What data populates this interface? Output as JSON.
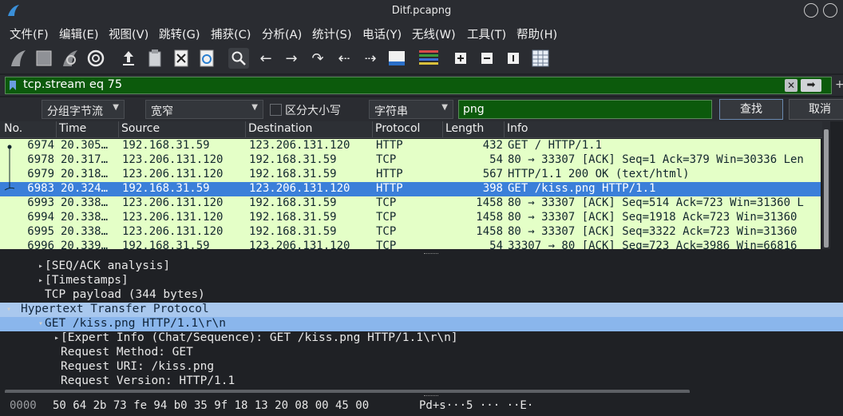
{
  "window": {
    "title": "Ditf.pcapng"
  },
  "menu": [
    "文件(F)",
    "编辑(E)",
    "视图(V)",
    "跳转(G)",
    "捕获(C)",
    "分析(A)",
    "统计(S)",
    "电话(Y)",
    "无线(W)",
    "工具(T)",
    "帮助(H)"
  ],
  "filter": {
    "value": "tcp.stream eq 75"
  },
  "find": {
    "scope": "分组字节流",
    "width": "宽窄",
    "case_label": "区分大小写",
    "type": "字符串",
    "query": "png",
    "find_button": "查找",
    "cancel_button": "取消"
  },
  "columns": [
    "No.",
    "Time",
    "Source",
    "Destination",
    "Protocol",
    "Length",
    "Info"
  ],
  "packets": [
    {
      "no": "6974",
      "time": "20.305…",
      "src": "192.168.31.59",
      "dst": "123.206.131.120",
      "proto": "HTTP",
      "len": "432",
      "info": "GET / HTTP/1.1",
      "selected": false
    },
    {
      "no": "6978",
      "time": "20.317…",
      "src": "123.206.131.120",
      "dst": "192.168.31.59",
      "proto": "TCP",
      "len": "54",
      "info": "80 → 33307 [ACK] Seq=1 Ack=379 Win=30336 Len",
      "selected": false
    },
    {
      "no": "6979",
      "time": "20.318…",
      "src": "123.206.131.120",
      "dst": "192.168.31.59",
      "proto": "HTTP",
      "len": "567",
      "info": "HTTP/1.1 200 OK  (text/html)",
      "selected": false
    },
    {
      "no": "6983",
      "time": "20.324…",
      "src": "192.168.31.59",
      "dst": "123.206.131.120",
      "proto": "HTTP",
      "len": "398",
      "info": "GET /kiss.png HTTP/1.1",
      "selected": true
    },
    {
      "no": "6993",
      "time": "20.338…",
      "src": "123.206.131.120",
      "dst": "192.168.31.59",
      "proto": "TCP",
      "len": "1458",
      "info": "80 → 33307 [ACK] Seq=514 Ack=723 Win=31360 L",
      "selected": false
    },
    {
      "no": "6994",
      "time": "20.338…",
      "src": "123.206.131.120",
      "dst": "192.168.31.59",
      "proto": "TCP",
      "len": "1458",
      "info": "80 → 33307 [ACK] Seq=1918 Ack=723 Win=31360",
      "selected": false
    },
    {
      "no": "6995",
      "time": "20.338…",
      "src": "123.206.131.120",
      "dst": "192.168.31.59",
      "proto": "TCP",
      "len": "1458",
      "info": "80 → 33307 [ACK] Seq=3322 Ack=723 Win=31360",
      "selected": false
    },
    {
      "no": "6996",
      "time": "20.339…",
      "src": "192.168.31.59",
      "dst": "123.206.131.120",
      "proto": "TCP",
      "len": "54",
      "info": "33307 → 80 [ACK] Seq=723 Ack=3986 Win=66816",
      "selected": false
    }
  ],
  "details": [
    {
      "indent": 1,
      "arrow": "▸",
      "text": "[SEQ/ACK analysis]",
      "highlight": ""
    },
    {
      "indent": 1,
      "arrow": "▸",
      "text": "[Timestamps]",
      "highlight": ""
    },
    {
      "indent": 1,
      "arrow": "",
      "text": "TCP payload (344 bytes)",
      "highlight": ""
    },
    {
      "indent": 0,
      "arrow": "▾",
      "text": "Hypertext Transfer Protocol",
      "highlight": "hl2"
    },
    {
      "indent": 1,
      "arrow": "▾",
      "text": "GET /kiss.png HTTP/1.1\\r\\n",
      "highlight": "hl"
    },
    {
      "indent": 2,
      "arrow": "▸",
      "text": "[Expert Info (Chat/Sequence): GET /kiss.png HTTP/1.1\\r\\n]",
      "highlight": ""
    },
    {
      "indent": 2,
      "arrow": "",
      "text": "Request Method: GET",
      "highlight": ""
    },
    {
      "indent": 2,
      "arrow": "",
      "text": "Request URI: /kiss.png",
      "highlight": ""
    },
    {
      "indent": 2,
      "arrow": "",
      "text": "Request Version: HTTP/1.1",
      "highlight": ""
    }
  ],
  "bytes": [
    {
      "offset": "0000",
      "hex": "50 64 2b 73 fe 94 b0 35  9f 18 13 20 08 00 45 00",
      "ascii": "Pd+s···5 ··· ··E·"
    }
  ]
}
